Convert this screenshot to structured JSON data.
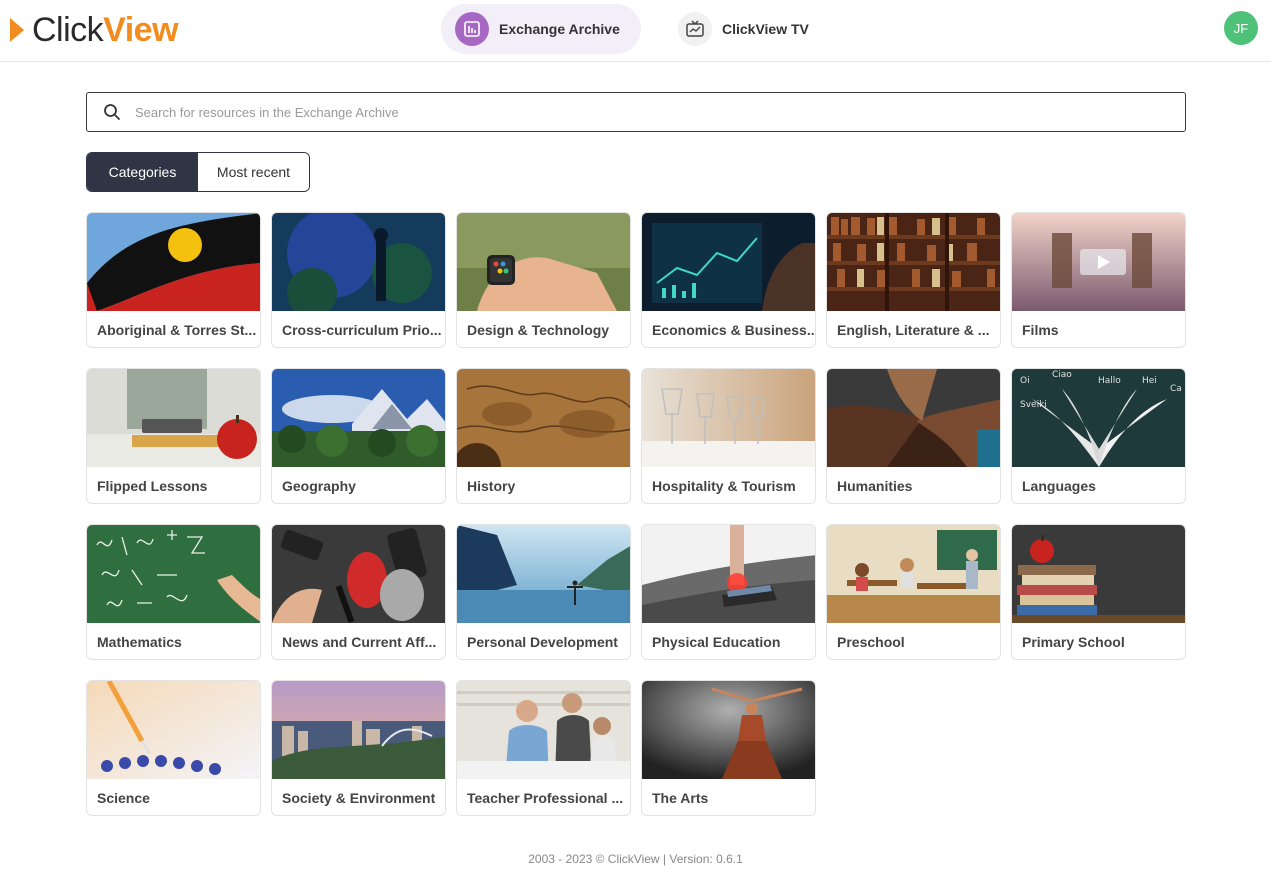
{
  "header": {
    "logo_click": "Click",
    "logo_view": "View",
    "tabs": [
      {
        "label": "Exchange Archive",
        "active": true,
        "icon": "archive-icon"
      },
      {
        "label": "ClickView TV",
        "active": false,
        "icon": "tv-icon"
      }
    ],
    "avatar_initials": "JF"
  },
  "search": {
    "placeholder": "Search for resources in the Exchange Archive",
    "value": ""
  },
  "view_toggle": {
    "options": [
      "Categories",
      "Most recent"
    ],
    "selected": "Categories"
  },
  "categories": [
    {
      "label": "Aboriginal & Torres St..."
    },
    {
      "label": "Cross-curriculum Prio..."
    },
    {
      "label": "Design & Technology"
    },
    {
      "label": "Economics & Business..."
    },
    {
      "label": "English, Literature & ..."
    },
    {
      "label": "Films"
    },
    {
      "label": "Flipped Lessons"
    },
    {
      "label": "Geography"
    },
    {
      "label": "History"
    },
    {
      "label": "Hospitality & Tourism"
    },
    {
      "label": "Humanities"
    },
    {
      "label": "Languages"
    },
    {
      "label": "Mathematics"
    },
    {
      "label": "News and Current Aff..."
    },
    {
      "label": "Personal Development"
    },
    {
      "label": "Physical Education"
    },
    {
      "label": "Preschool"
    },
    {
      "label": "Primary School"
    },
    {
      "label": "Science"
    },
    {
      "label": "Society & Environment"
    },
    {
      "label": "Teacher Professional ..."
    },
    {
      "label": "The Arts"
    }
  ],
  "footer": {
    "text": "2003 - 2023 © ClickView | Version: 0.6.1"
  },
  "colors": {
    "brand_orange": "#f28c1e",
    "active_tab_bg": "#f3eff8",
    "active_tab_icon": "#a768c4",
    "toggle_dark": "#2f3545",
    "avatar": "#4fc27a"
  }
}
